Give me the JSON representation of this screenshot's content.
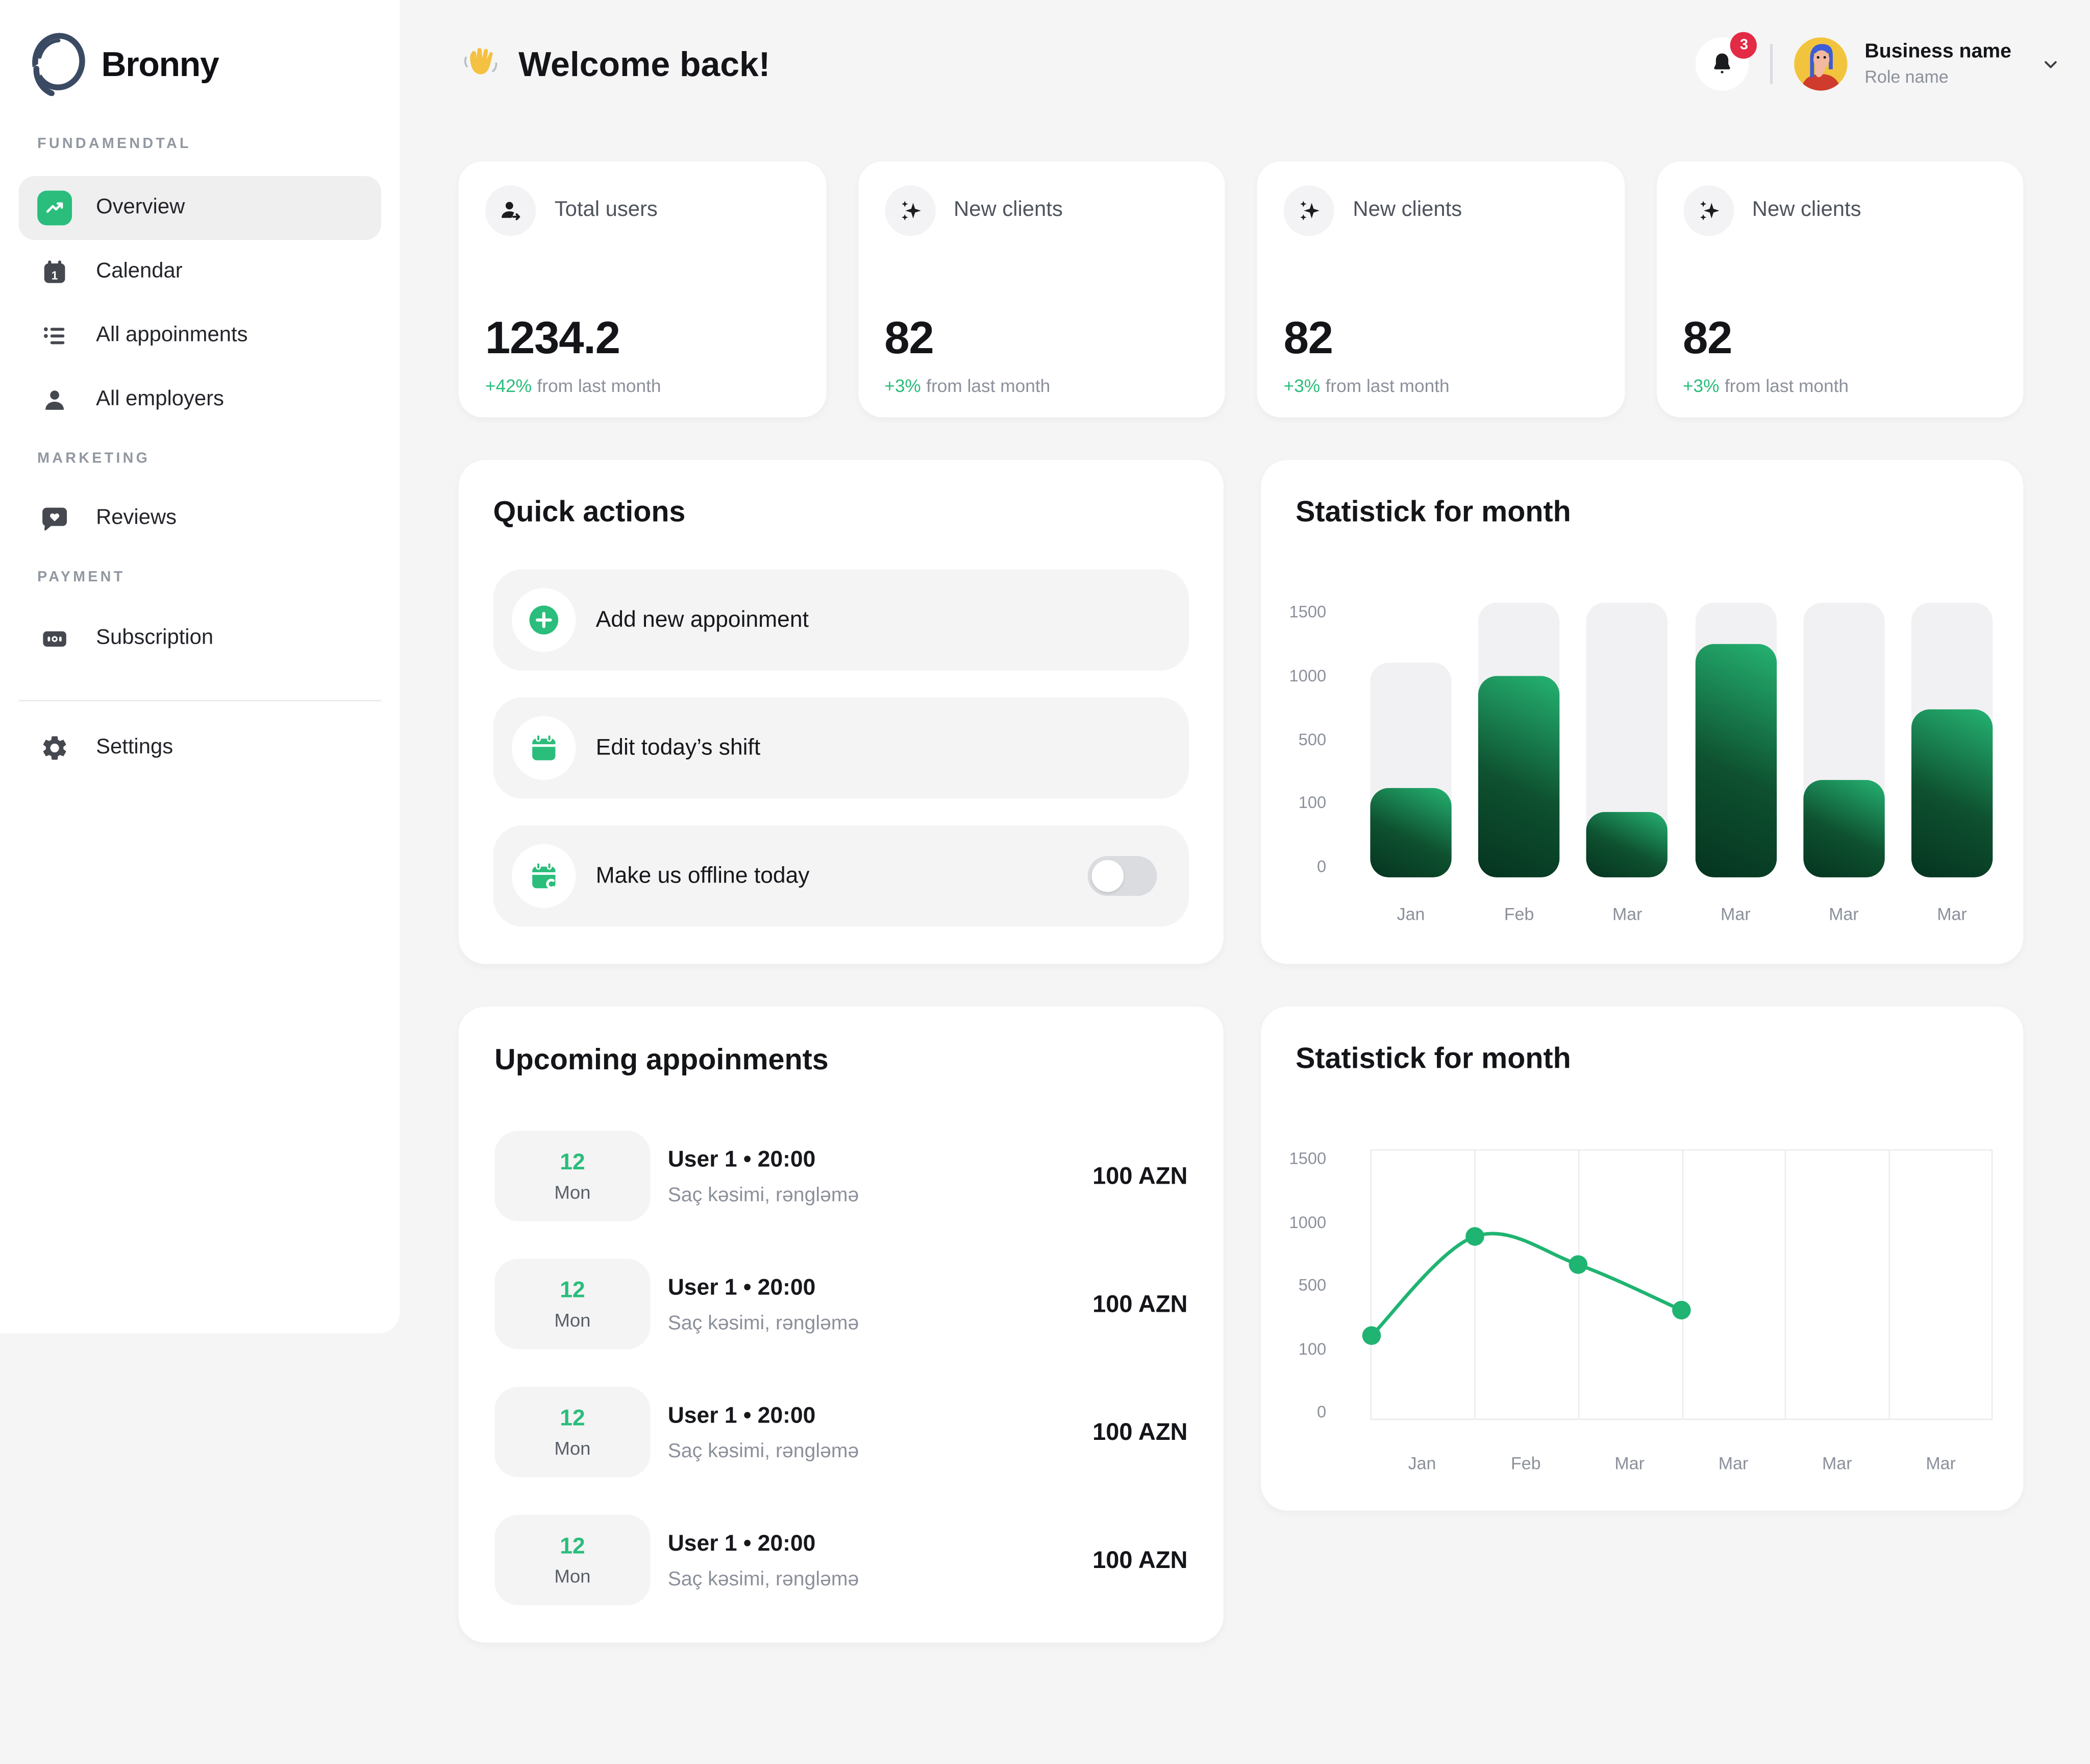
{
  "brand": {
    "name": "Bronny"
  },
  "sidebar": {
    "sections": [
      {
        "label": "FUNDAMENDTAL"
      },
      {
        "label": "MARKETING"
      },
      {
        "label": "PAYMENT"
      }
    ],
    "items": {
      "overview": "Overview",
      "calendar": "Calendar",
      "appointments": "All appoinments",
      "employers": "All employers",
      "reviews": "Reviews",
      "subscription": "Subscription",
      "settings": "Settings"
    }
  },
  "header": {
    "greeting": "Welcome back!",
    "notification_count": "3",
    "business_name": "Business name",
    "role_name": "Role name"
  },
  "stat_cards": [
    {
      "icon": "user-plus-icon",
      "label": "Total users",
      "value": "1234.2",
      "delta": "+42%",
      "delta_text": "from last month"
    },
    {
      "icon": "sparkles-icon",
      "label": "New clients",
      "value": "82",
      "delta": "+3%",
      "delta_text": "from last month"
    },
    {
      "icon": "sparkles-icon",
      "label": "New clients",
      "value": "82",
      "delta": "+3%",
      "delta_text": "from last month"
    },
    {
      "icon": "sparkles-icon",
      "label": "New clients",
      "value": "82",
      "delta": "+3%",
      "delta_text": "from last month"
    }
  ],
  "quick_actions": {
    "title": "Quick actions",
    "items": [
      {
        "label": "Add new appoinment"
      },
      {
        "label": "Edit today’s shift"
      },
      {
        "label": "Make us offline today",
        "toggle_state": "off"
      }
    ]
  },
  "upcoming": {
    "title": "Upcoming appoinments",
    "rows": [
      {
        "date": "12",
        "day": "Mon",
        "title": "User 1 • 20:00",
        "subtitle": "Saç kəsimi, rəngləmə",
        "price": "100 AZN"
      },
      {
        "date": "12",
        "day": "Mon",
        "title": "User 1 • 20:00",
        "subtitle": "Saç kəsimi, rəngləmə",
        "price": "100 AZN"
      },
      {
        "date": "12",
        "day": "Mon",
        "title": "User 1 • 20:00",
        "subtitle": "Saç kəsimi, rəngləmə",
        "price": "100 AZN"
      },
      {
        "date": "12",
        "day": "Mon",
        "title": "User 1 • 20:00",
        "subtitle": "Saç kəsimi, rəngləmə",
        "price": "100 AZN"
      }
    ]
  },
  "chart_data": [
    {
      "type": "bar",
      "title": "Statistick for month",
      "categories": [
        "Jan",
        "Feb",
        "Mar",
        "Mar",
        "Mar",
        "Mar"
      ],
      "values": [
        200,
        1000,
        85,
        1250,
        250,
        700
      ],
      "track_max_values": [
        1100,
        1500,
        1500,
        1500,
        1500,
        1500
      ],
      "y_ticks": [
        "1500",
        "1000",
        "500",
        "100",
        "0"
      ],
      "ylim": [
        0,
        1500
      ],
      "grid": false,
      "legend": "none",
      "bar_height_pct": [
        32.5,
        73.5,
        24,
        85,
        35.5,
        61
      ],
      "track_height_pct": [
        78,
        100,
        100,
        100,
        100,
        100
      ],
      "bar_color_top": "#25b372",
      "bar_color_bottom": "#05341f",
      "track_color": "#f1f1f3"
    },
    {
      "type": "line",
      "title": "Statistick for month",
      "categories": [
        "Jan",
        "Feb",
        "Mar",
        "Mar",
        "Mar",
        "Mar"
      ],
      "x_points": [
        "Jan",
        "Feb",
        "Mar",
        "Mar"
      ],
      "values": [
        150,
        900,
        650,
        350
      ],
      "y_ticks": [
        "1500",
        "1000",
        "500",
        "100",
        "0"
      ],
      "ylim": [
        0,
        1500
      ],
      "grid": "vertical",
      "legend": "none",
      "point_pos_pct": [
        {
          "x": 0,
          "y": 69
        },
        {
          "x": 16.67,
          "y": 32
        },
        {
          "x": 33.33,
          "y": 42.5
        },
        {
          "x": 50,
          "y": 59.5
        }
      ],
      "line_color": "#1fb471"
    }
  ]
}
